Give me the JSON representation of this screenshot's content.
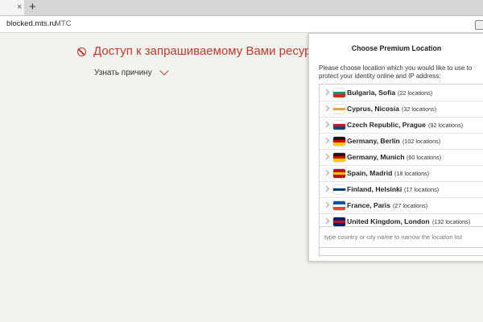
{
  "browser": {
    "tab_close_icon": "close-icon",
    "new_tab_symbol": "+",
    "tab_close_symbol": "×",
    "url": "blocked.mts.ru",
    "site_title": "МТС"
  },
  "blocked_page": {
    "heading": "Доступ к запрашиваемому Вами ресурсу",
    "reason_link": "Узнать причину",
    "accent_color": "#c0392b"
  },
  "popup": {
    "title": "Choose Premium Location",
    "description": "Please choose location which you would like to use to protect your identity online and IP address:",
    "search_placeholder": "type country or city name to narrow the location list",
    "locations": [
      {
        "name": "Bulgaria, Sofia",
        "count": "(22 locations)",
        "flag": [
          "#ffffff",
          "#00966e",
          "#d62612"
        ]
      },
      {
        "name": "Cyprus, Nicosia",
        "count": "(32 locations)",
        "flag": [
          "#ffffff",
          "#e8a33c",
          "#ffffff"
        ]
      },
      {
        "name": "Czech Republic, Prague",
        "count": "(92 locations)",
        "flag": [
          "#ffffff",
          "#d7141a",
          "#11457e"
        ]
      },
      {
        "name": "Germany, Berlin",
        "count": "(102 locations)",
        "flag": [
          "#1a1a1a",
          "#dd0000",
          "#ffce00"
        ]
      },
      {
        "name": "Germany, Munich",
        "count": "(60 locations)",
        "flag": [
          "#1a1a1a",
          "#dd0000",
          "#ffce00"
        ]
      },
      {
        "name": "Spain, Madrid",
        "count": "(18 locations)",
        "flag": [
          "#c60b1e",
          "#ffc400",
          "#c60b1e"
        ]
      },
      {
        "name": "Finland, Helsinki",
        "count": "(17 locations)",
        "flag": [
          "#ffffff",
          "#003580",
          "#ffffff"
        ]
      },
      {
        "name": "France, Paris",
        "count": "(27 locations)",
        "flag": [
          "#0055a4",
          "#ffffff",
          "#ef4135"
        ]
      },
      {
        "name": "United Kingdom, London",
        "count": "(132 locations)",
        "flag": [
          "#012169",
          "#c8102e",
          "#012169"
        ]
      }
    ]
  }
}
